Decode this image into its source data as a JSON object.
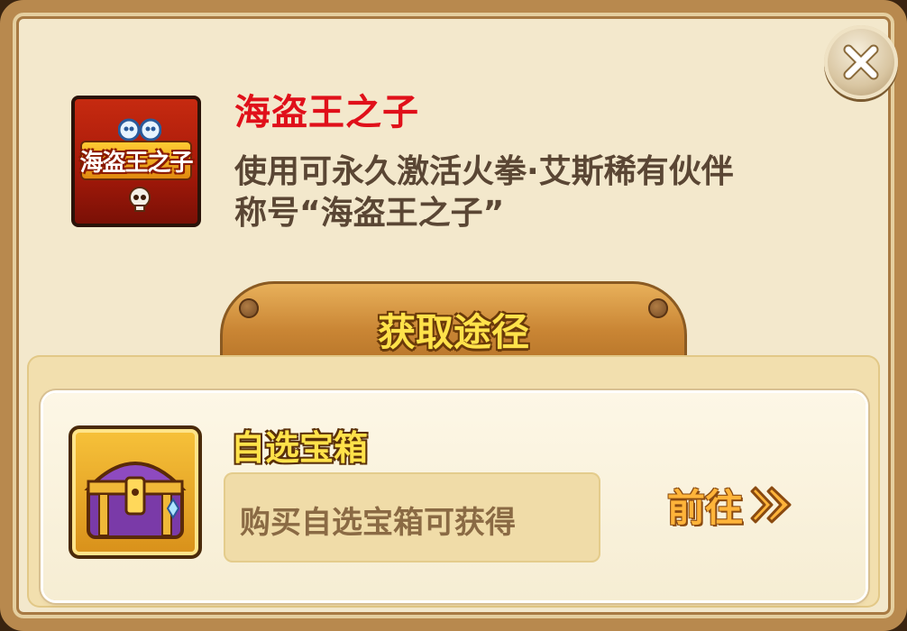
{
  "dialog": {
    "close_icon": "close-icon"
  },
  "item": {
    "icon_text": "海盗王之子",
    "title": "海盗王之子",
    "description_line1": "使用可永久激活火拳·艾斯稀有伙伴",
    "description_line2": "称号“海盗王之子”",
    "title_color": "#e0101a"
  },
  "acquire": {
    "tab_label": "获取途径",
    "sources": [
      {
        "icon": "treasure-chest-icon",
        "name": "自选宝箱",
        "description": "购买自选宝箱可获得",
        "go_label": "前往",
        "go_icon": "double-chevron-right-icon"
      }
    ]
  }
}
